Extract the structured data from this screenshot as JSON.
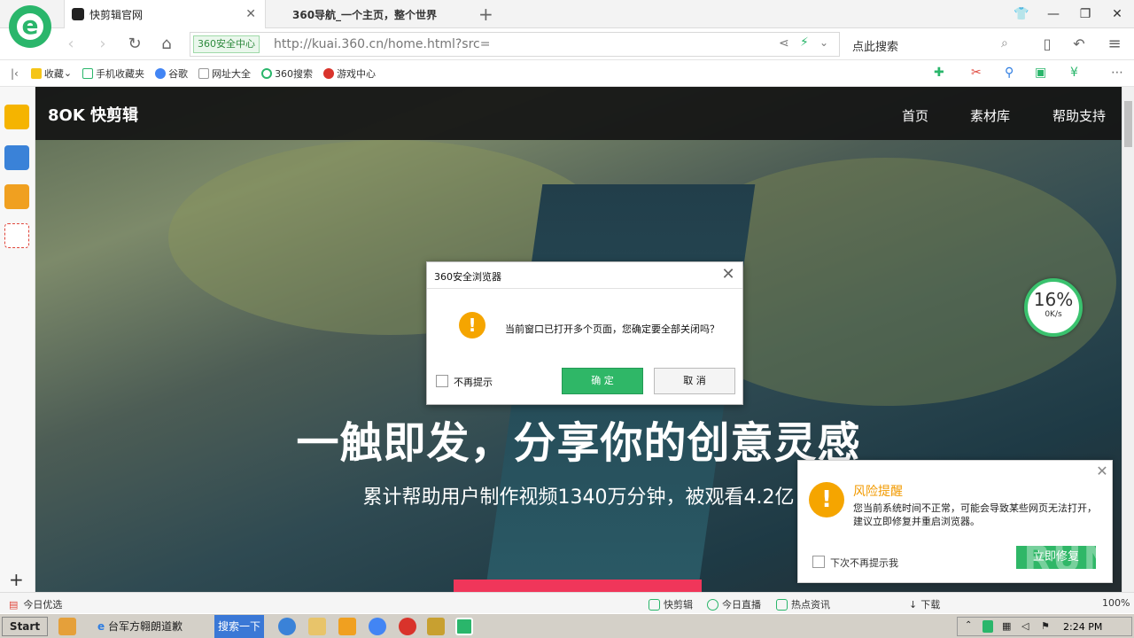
{
  "tabs": [
    {
      "title": "快剪辑官网",
      "active": true
    },
    {
      "title": "360导航_一个主页，整个世界",
      "active": false
    }
  ],
  "address": {
    "security_badge": "360安全中心",
    "url": "http://kuai.360.cn/home.html?src=",
    "search_placeholder": "点此搜索"
  },
  "bookmarks": [
    "收藏",
    "手机收藏夹",
    "谷歌",
    "网址大全",
    "360搜索",
    "游戏中心"
  ],
  "page": {
    "logo": "8OK 快剪辑",
    "nav": [
      "首页",
      "素材库",
      "帮助支持"
    ],
    "headline": "一触即发，分享你的创意灵感",
    "subline": "累计帮助用户制作视频1340万分钟，被观看4.2亿"
  },
  "speed_widget": {
    "percent": "16%",
    "rate": "0K/s"
  },
  "dialog": {
    "title": "360安全浏览器",
    "message": "当前窗口已打开多个页面，您确定要全部关闭吗？",
    "checkbox_label": "不再提示",
    "ok": "确 定",
    "cancel": "取 消"
  },
  "risk_popup": {
    "title": "风险提醒",
    "body": "您当前系统时间不正常，可能会导致某些网页无法打开，建议立即修复并重启浏览器。",
    "checkbox_label": "下次不再提示我",
    "button": "立即修复"
  },
  "statusbar": {
    "left": "今日优选",
    "items": [
      "快剪辑",
      "今日直播",
      "热点资讯",
      "下载"
    ],
    "zoom": "100%"
  },
  "taskbar": {
    "start": "Start",
    "app_label": "台军方翱朗道歉",
    "search": "搜索一下",
    "clock": "2:24 PM"
  },
  "watermark": "ANY RUN"
}
